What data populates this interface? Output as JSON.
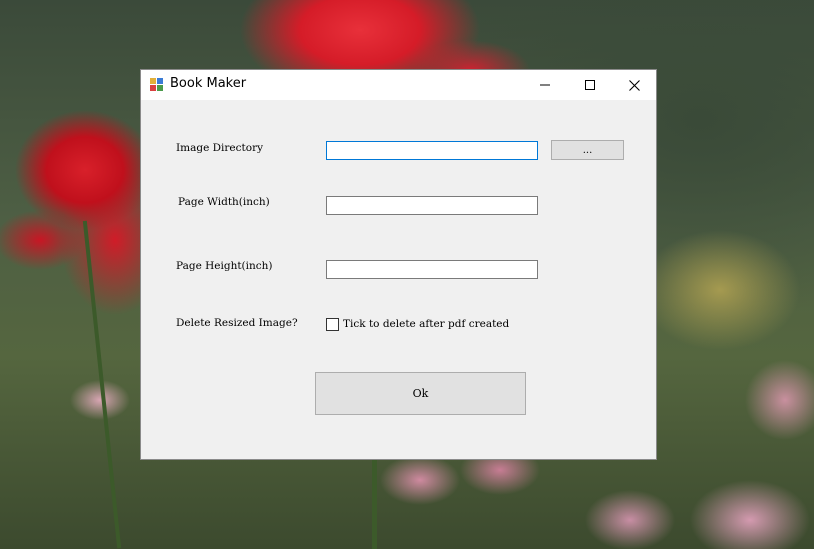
{
  "window": {
    "title": "Book Maker",
    "controls": {
      "minimize": "minimize-icon",
      "maximize": "maximize-icon",
      "close": "close-icon"
    }
  },
  "form": {
    "image_directory_label": "Image Directory",
    "image_directory_value": "",
    "browse_label": "...",
    "page_width_label": "Page Width(inch)",
    "page_width_value": "",
    "page_height_label": "Page Height(inch)",
    "page_height_value": "",
    "delete_label": "Delete Resized Image?",
    "delete_checkbox_label": "Tick to delete after pdf created",
    "delete_checked": false,
    "ok_label": "Ok"
  },
  "colors": {
    "accent_focus": "#0078d7",
    "window_bg": "#f0f0f0",
    "titlebar_bg": "#ffffff"
  }
}
